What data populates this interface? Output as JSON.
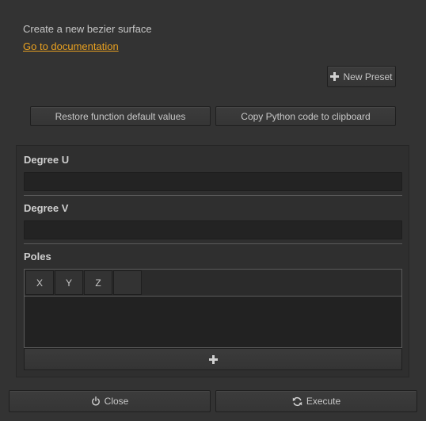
{
  "header": {
    "description": "Create a new bezier surface",
    "doc_link": "Go to documentation"
  },
  "toolbar": {
    "new_preset_label": "New Preset",
    "new_preset_icon": "plus-icon",
    "restore_label": "Restore function default values",
    "copy_label": "Copy Python code to clipboard"
  },
  "params": {
    "degree_u": {
      "label": "Degree U",
      "value": ""
    },
    "degree_v": {
      "label": "Degree V",
      "value": ""
    },
    "poles": {
      "label": "Poles",
      "columns": [
        "X",
        "Y",
        "Z",
        ""
      ],
      "rows": [],
      "add_icon": "plus-icon"
    }
  },
  "footer": {
    "close_label": "Close",
    "close_icon": "power-icon",
    "execute_label": "Execute",
    "execute_icon": "refresh-icon"
  },
  "colors": {
    "background": "#333333",
    "link": "#e8a020",
    "field": "#232323"
  }
}
